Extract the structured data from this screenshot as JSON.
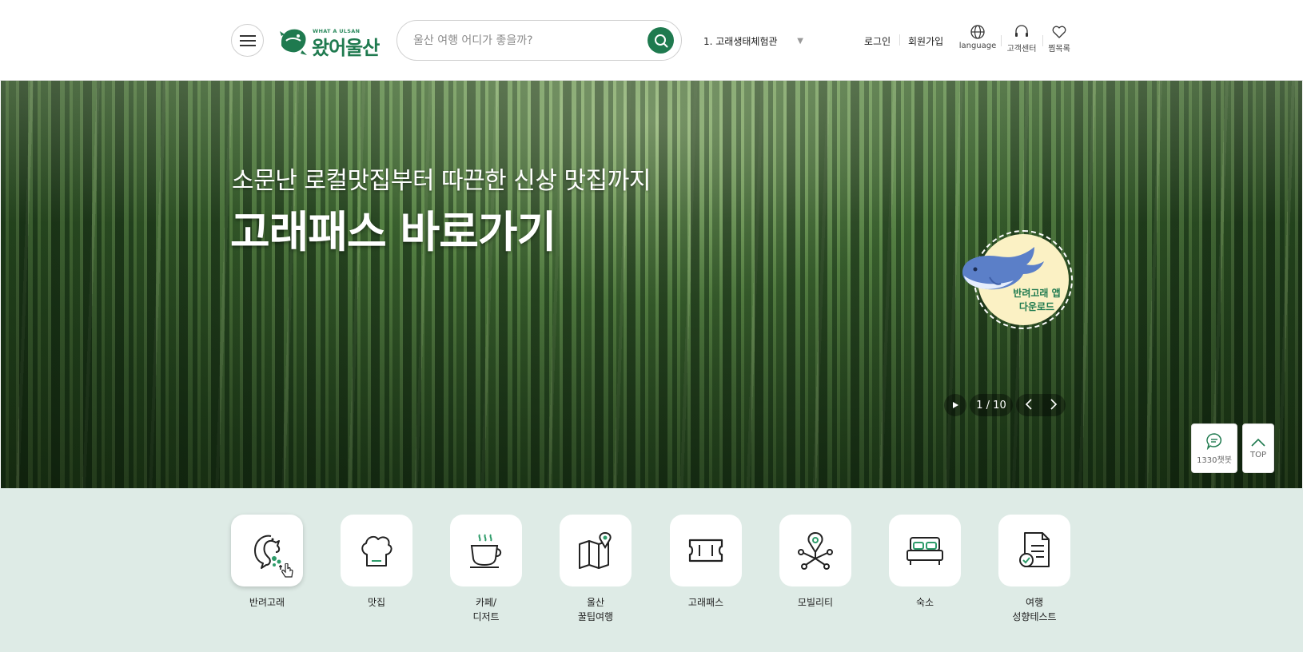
{
  "header": {
    "logo": {
      "small": "WHAT A ULSAN",
      "big": "왔어울산"
    },
    "search": {
      "placeholder": "울산 여행 어디가 좋을까?"
    },
    "ranking": {
      "current": "1. 고래생태체험관"
    },
    "links": {
      "login": "로그인",
      "signup": "회원가입"
    },
    "icons": [
      {
        "name": "globe-icon",
        "label": "language"
      },
      {
        "name": "headset-icon",
        "label": "고객센터"
      },
      {
        "name": "heart-icon",
        "label": "찜목록"
      }
    ]
  },
  "hero": {
    "subtitle": "소문난 로컬맛집부터 따끈한 신상 맛집까지",
    "title": "고래패스 바로가기",
    "badge": {
      "line1": "반려고래 앱",
      "line2": "다운로드"
    },
    "slider": {
      "counter": "1 / 10"
    }
  },
  "floating": {
    "chatbot": "1330챗봇",
    "top": "TOP"
  },
  "quick_menu": [
    {
      "label": "반려고래",
      "icon": "dolphin-icon"
    },
    {
      "label": "맛집",
      "icon": "chef-hat-icon"
    },
    {
      "label": "카페/\n디저트",
      "icon": "coffee-cup-icon"
    },
    {
      "label": "울산\n꿀팁여행",
      "icon": "map-pin-icon"
    },
    {
      "label": "고래패스",
      "icon": "ticket-icon"
    },
    {
      "label": "모빌리티",
      "icon": "mobility-network-icon"
    },
    {
      "label": "숙소",
      "icon": "bed-icon"
    },
    {
      "label": "여행\n성향테스트",
      "icon": "document-check-icon"
    }
  ],
  "colors": {
    "brand": "#1f7a4f",
    "quick_bg": "#deebe6",
    "badge_bg": "#fbf1c4"
  }
}
